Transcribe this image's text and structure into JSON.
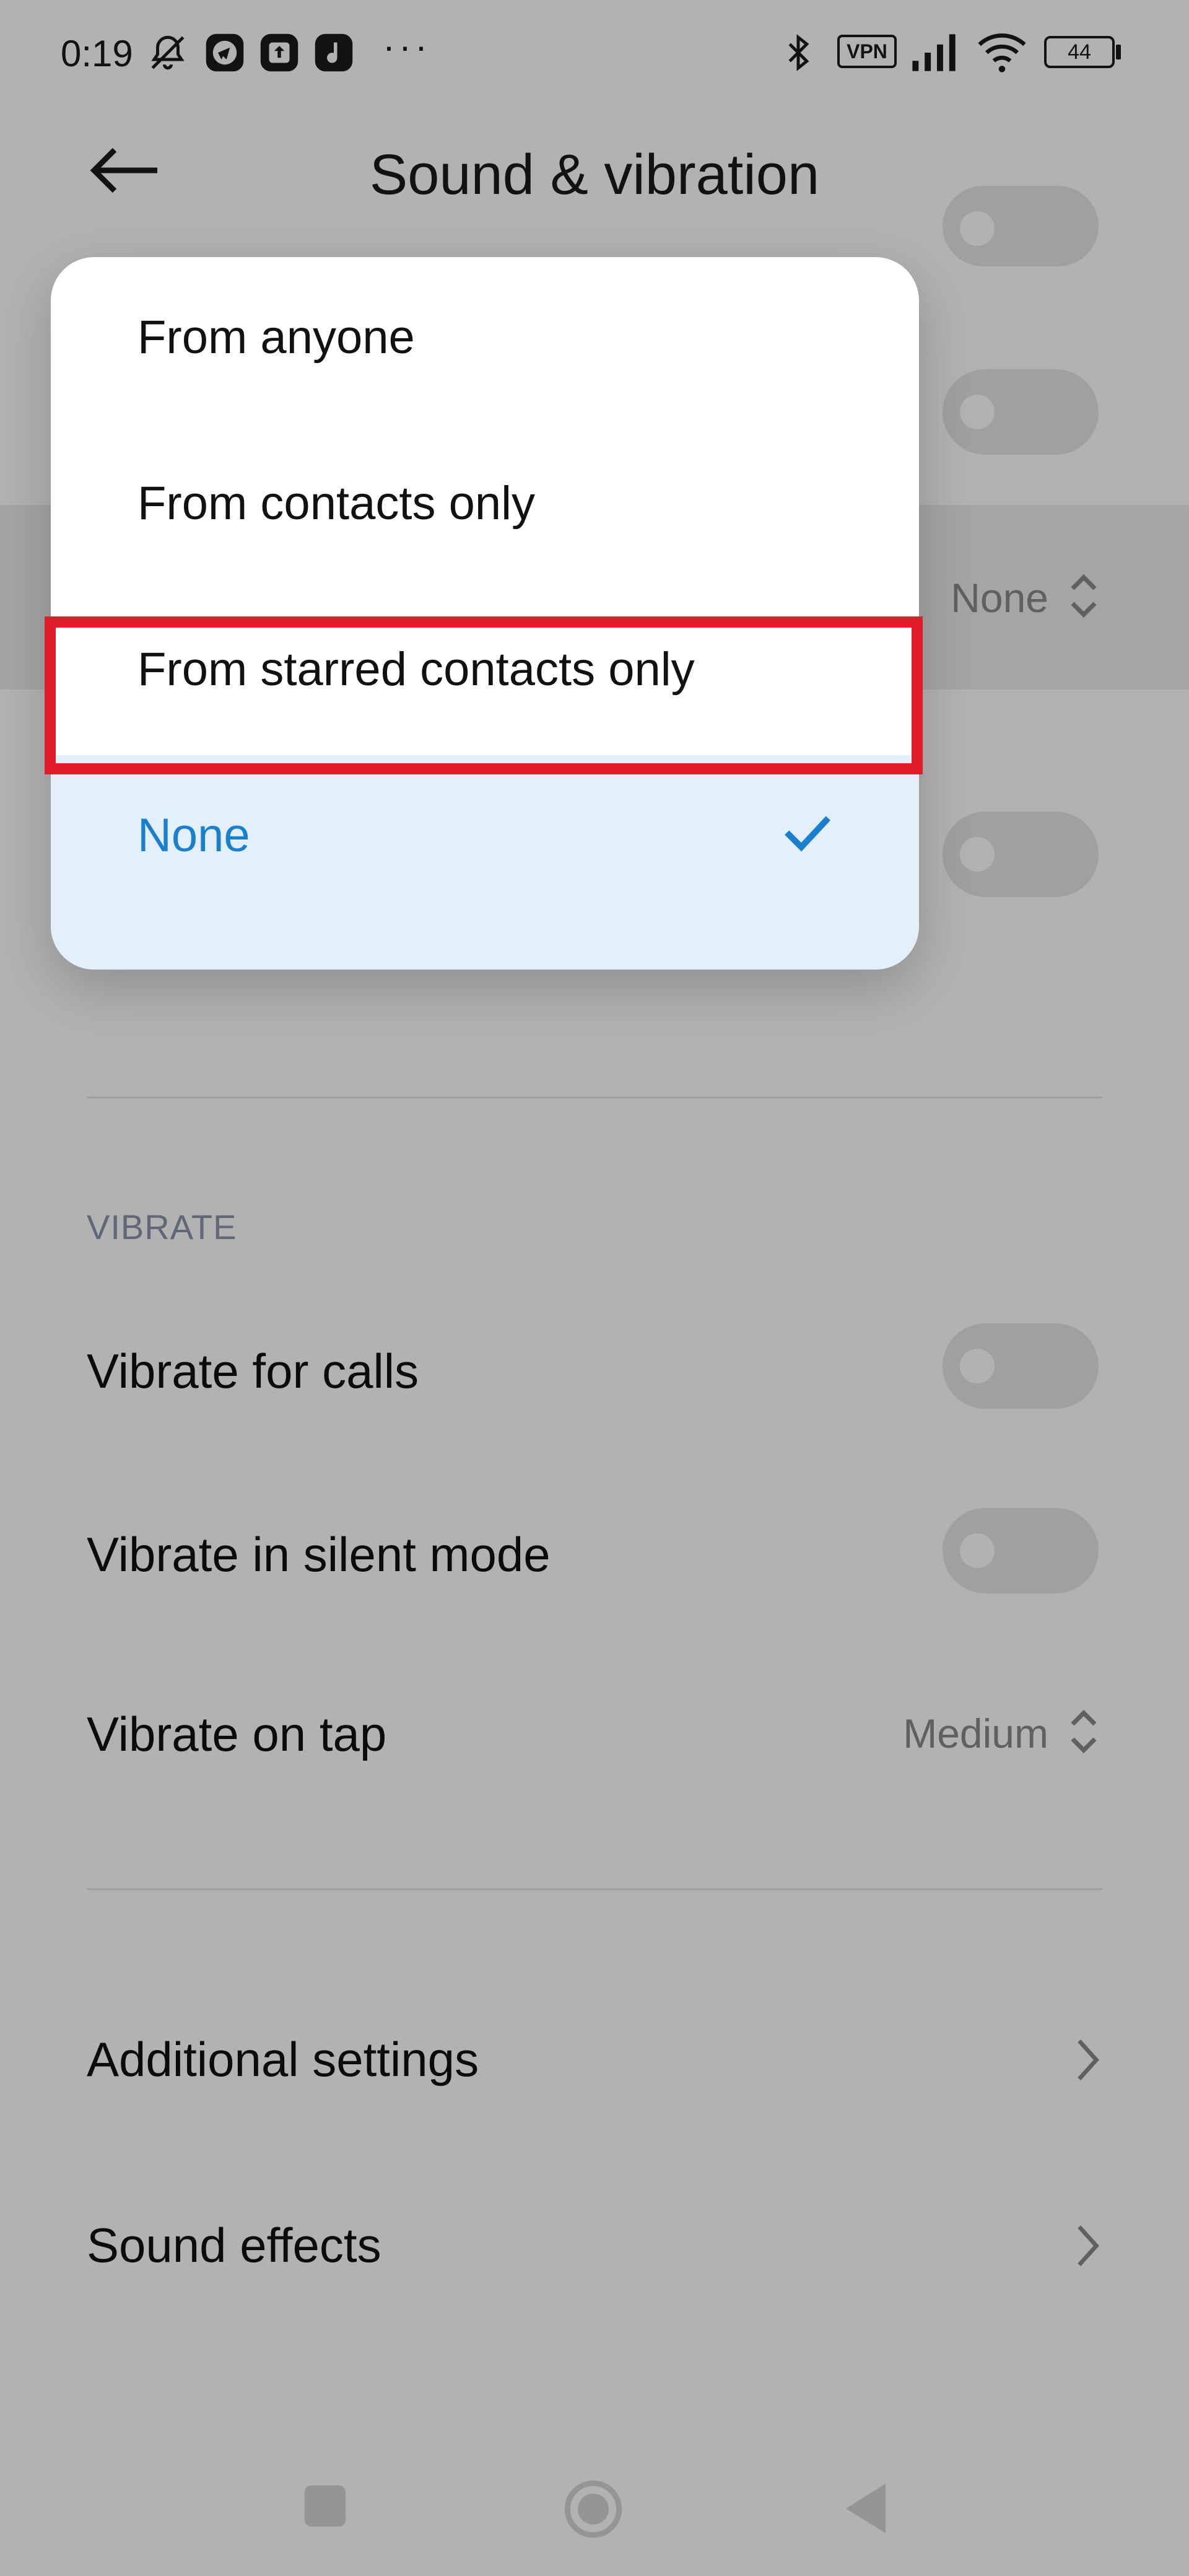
{
  "status_bar": {
    "time": "0:19",
    "more": "···",
    "vpn_label": "VPN",
    "battery": "44"
  },
  "header": {
    "title": "Sound & vibration"
  },
  "background": {
    "setting_value": "None",
    "vibrate_section": "VIBRATE",
    "vibrate_for_calls": "Vibrate for calls",
    "vibrate_in_silent": "Vibrate in silent mode",
    "vibrate_on_tap": "Vibrate on tap",
    "vibrate_on_tap_value": "Medium",
    "additional_settings": "Additional settings",
    "sound_effects": "Sound effects"
  },
  "popup": {
    "options": [
      {
        "label": "From anyone"
      },
      {
        "label": "From contacts only"
      },
      {
        "label": "From starred contacts only"
      },
      {
        "label": "None"
      }
    ],
    "selected_index": 3
  },
  "colors": {
    "accent": "#1a7fcc",
    "focus_outline": "#e01e2a"
  }
}
